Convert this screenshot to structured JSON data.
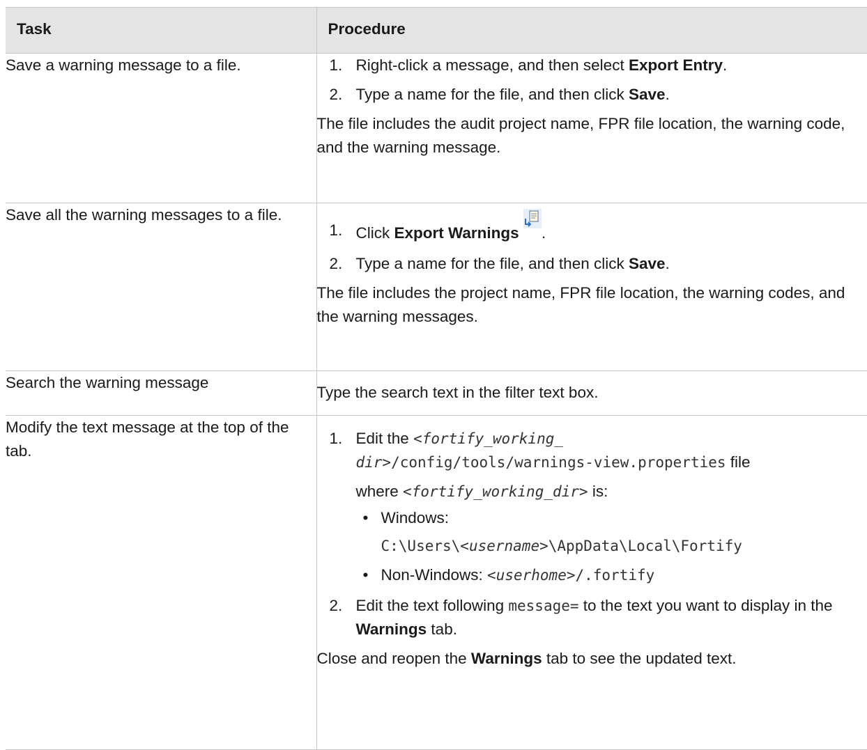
{
  "header": {
    "task": "Task",
    "procedure": "Procedure"
  },
  "rows": [
    {
      "task": "Save a warning message to a file.",
      "step1": {
        "num": "1.",
        "text": "Right-click a message, and then select ",
        "bold": "Export Entry",
        "end": "."
      },
      "step2": {
        "num": "2.",
        "text": "Type a name for the file, and then click ",
        "bold": "Save",
        "end": "."
      },
      "note": "The file includes the audit project name, FPR file location, the warning code, and the warning message."
    },
    {
      "task": "Save all the warning messages to a file.",
      "step1": {
        "num": "1.",
        "text": "Click ",
        "bold": "Export Warnings",
        "end": "."
      },
      "step2": {
        "num": "2.",
        "text": "Type a name for the file, and then click ",
        "bold": "Save",
        "end": "."
      },
      "note": "The file includes the project name, FPR file location, the warning codes, and the warning messages."
    },
    {
      "task": "Search the warning message",
      "text": "Type the search text in the filter text box."
    },
    {
      "task": "Modify the text message at the top of the tab.",
      "step1": {
        "num": "1.",
        "edit": "Edit the ",
        "var1": "<fortify_working_",
        "var2": "dir>",
        "path": "/config/tools/warnings-view.properties",
        "file": " file",
        "where": "where ",
        "var_full": "<fortify_working_dir>",
        "is": " is:",
        "win_label": "Windows:",
        "win_path_a": "C:\\Users\\",
        "win_user": "<username>",
        "win_path_b": "\\AppData\\Local\\Fortify",
        "nonwin_label": "Non-Windows: ",
        "nonwin_user": "<userhome>",
        "nonwin_path": "/.fortify"
      },
      "step2": {
        "num": "2.",
        "pre": "Edit the text following ",
        "code": "message=",
        "post": " to the text you want to display in the ",
        "bold": "Warnings",
        "end": " tab."
      },
      "note": {
        "pre": "Close and reopen the ",
        "bold": "Warnings",
        "post": " tab to see the updated text."
      }
    }
  ],
  "icons": {
    "export_warnings": "export-warnings-icon"
  }
}
